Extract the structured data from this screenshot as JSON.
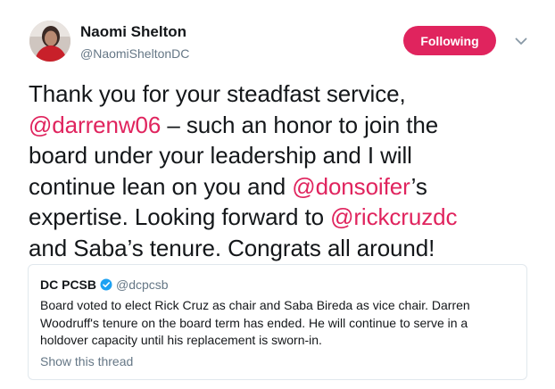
{
  "author": {
    "name": "Naomi Shelton",
    "handle": "@NaomiSheltonDC",
    "avatar_icon": "profile-photo"
  },
  "follow_button": {
    "label": "Following",
    "color": "#e0245e"
  },
  "menu_icon": "chevron-down-icon",
  "tweet": {
    "lines": [
      [
        {
          "text": "Thank you for your steadfast service,"
        }
      ],
      [
        {
          "text": "@darrenw06",
          "mention": true
        },
        {
          "text": " – such an honor to join the"
        }
      ],
      [
        {
          "text": "board under your leadership and I will"
        }
      ],
      [
        {
          "text": "continue lean on you and "
        },
        {
          "text": "@donsoifer",
          "mention": true
        },
        {
          "text": "’s"
        }
      ],
      [
        {
          "text": "expertise. Looking forward to "
        },
        {
          "text": "@rickcruzdc",
          "mention": true
        }
      ],
      [
        {
          "text": "and Saba’s tenure. Congrats all around!"
        }
      ]
    ],
    "mention_color": "#e0245e"
  },
  "quoted_tweet": {
    "name": "DC PCSB",
    "verified_icon": "verified-badge-icon",
    "handle": "@dcpcsb",
    "lines": [
      "Board voted to elect Rick Cruz as chair and Saba Bireda as vice chair. Darren",
      "Woodruff's tenure on the board term has ended. He will continue to serve in a",
      "holdover capacity until his replacement is sworn-in."
    ],
    "show_thread": "Show this thread"
  }
}
